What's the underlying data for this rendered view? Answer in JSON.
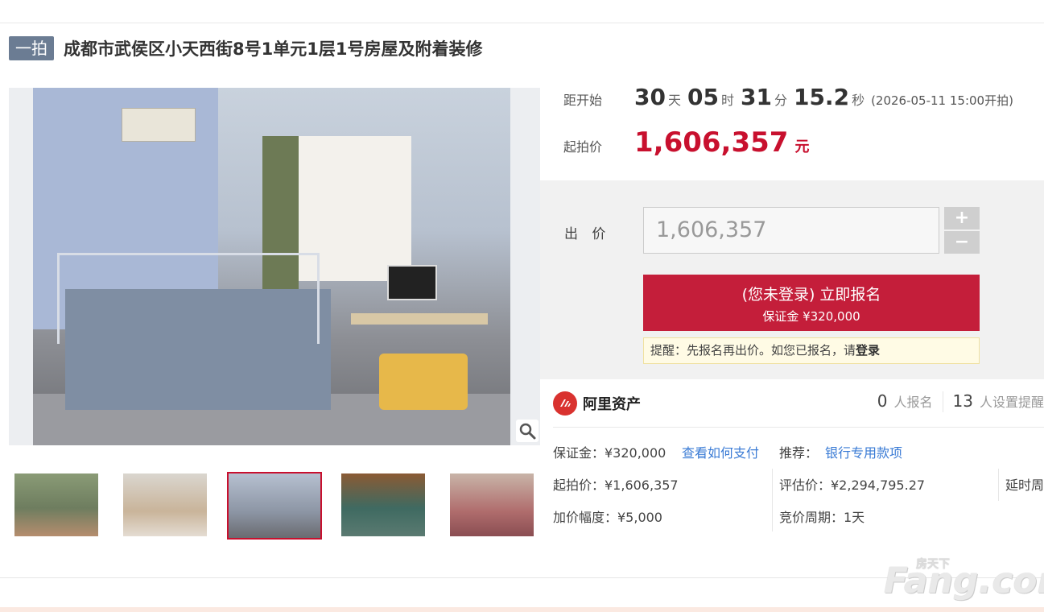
{
  "title": {
    "tag": "一拍",
    "text": "成都市武侯区小天西街8号1单元1层1号房屋及附着装修"
  },
  "countdown": {
    "label": "距开始",
    "days": "30",
    "days_unit": "天",
    "hours": "05",
    "hours_unit": "时",
    "minutes": "31",
    "minutes_unit": "分",
    "seconds": "15.2",
    "seconds_unit": "秒",
    "start_text": "(2026-05-11 15:00开拍)"
  },
  "start_price": {
    "label": "起拍价",
    "value": "1,606,357",
    "unit": "元"
  },
  "bid": {
    "label": "出 价",
    "input_value": "1,606,357",
    "plus": "+",
    "minus": "−",
    "signup_line1": "(您未登录) 立即报名",
    "signup_line2": "保证金 ¥320,000",
    "notice_text": "提醒：先报名再出价。如您已报名，请",
    "notice_link": "登录"
  },
  "ali": {
    "name": "阿里资产",
    "signups": "0",
    "signups_label": "人报名",
    "reminders": "13",
    "reminders_label": "人设置提醒"
  },
  "details": {
    "deposit": "保证金：¥320,000",
    "how_to_pay": "查看如何支付",
    "recommend_label": "推荐：",
    "recommend_link": "银行专用款项",
    "start_price": "起拍价：¥1,606,357",
    "appraisal": "评估价：¥2,294,795.27",
    "delay": "延时周",
    "increment": "加价幅度：¥5,000",
    "cycle": "竞价周期：1天"
  },
  "watermark": {
    "main": "Fang.com",
    "sub": "房天下"
  },
  "colors": {
    "accent": "#c8102e",
    "button": "#c41e3a",
    "tag": "#6b7c93",
    "link": "#3a7bd5"
  }
}
